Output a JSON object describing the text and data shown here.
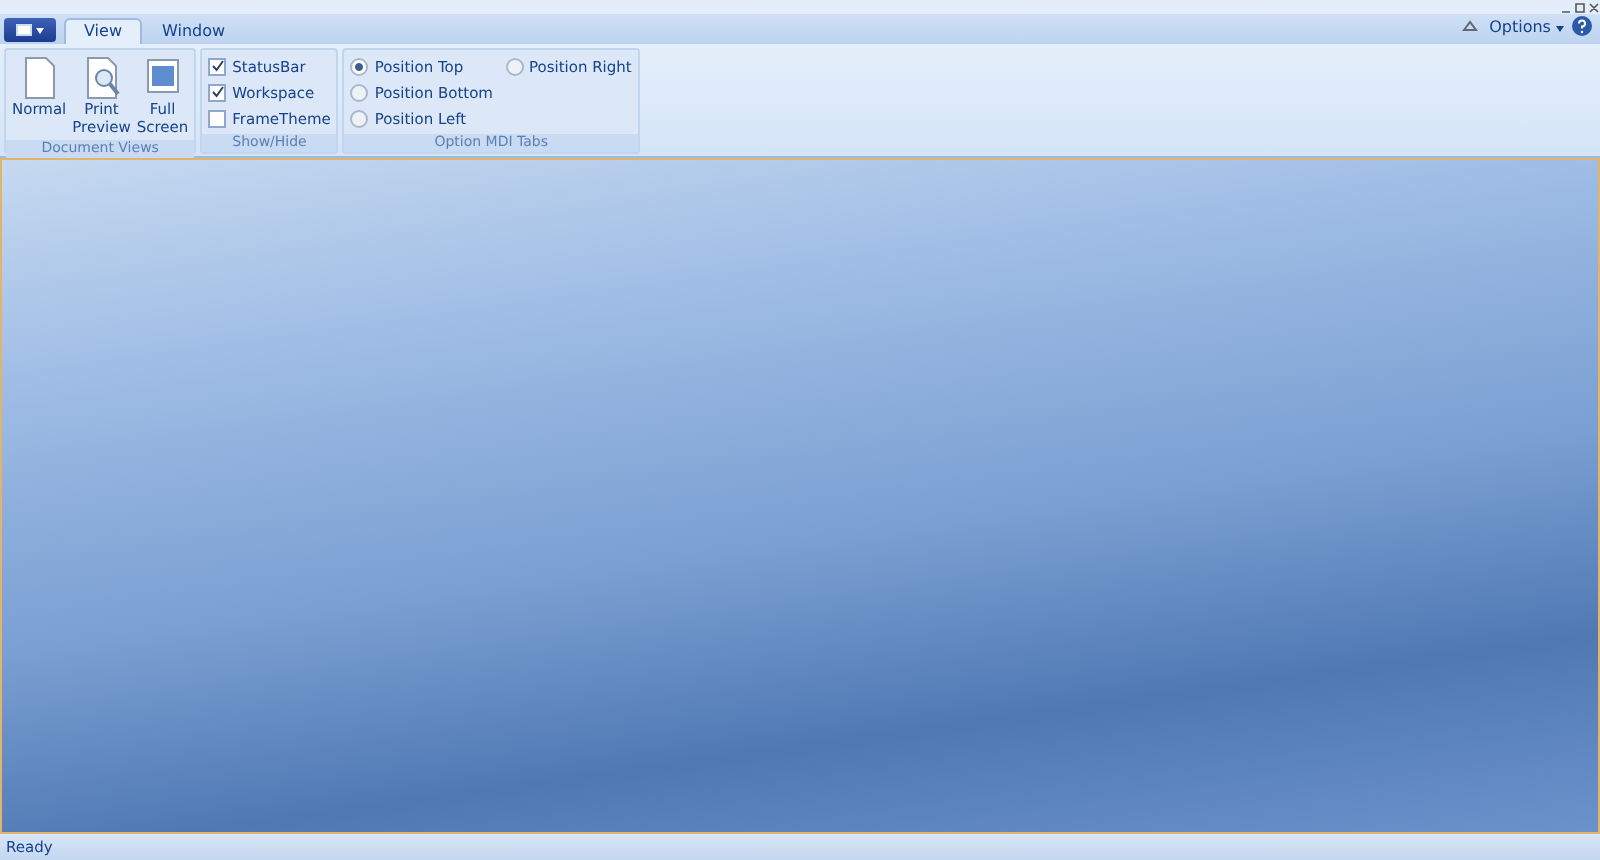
{
  "tabs": [
    {
      "label": "View",
      "selected": true
    },
    {
      "label": "Window",
      "selected": false
    }
  ],
  "options": {
    "label": "Options"
  },
  "groups": [
    {
      "kind": "buttons",
      "title": "Document Views",
      "items": [
        {
          "label": "Normal"
        },
        {
          "label": "Print\nPreview"
        },
        {
          "label": "Full\nScreen"
        }
      ]
    },
    {
      "kind": "checks",
      "title": "Show/Hide",
      "items": [
        {
          "label": "StatusBar",
          "checked": true
        },
        {
          "label": "Workspace",
          "checked": true
        },
        {
          "label": "FrameTheme",
          "checked": false
        }
      ]
    },
    {
      "kind": "radios",
      "title": "Option MDI Tabs",
      "items": [
        {
          "label": "Position Top",
          "selected": true
        },
        {
          "label": "Position Bottom",
          "selected": false
        },
        {
          "label": "Position Left",
          "selected": false
        },
        {
          "label": "Position Right",
          "selected": false
        }
      ]
    }
  ],
  "status_bar": {
    "text": "Ready"
  }
}
